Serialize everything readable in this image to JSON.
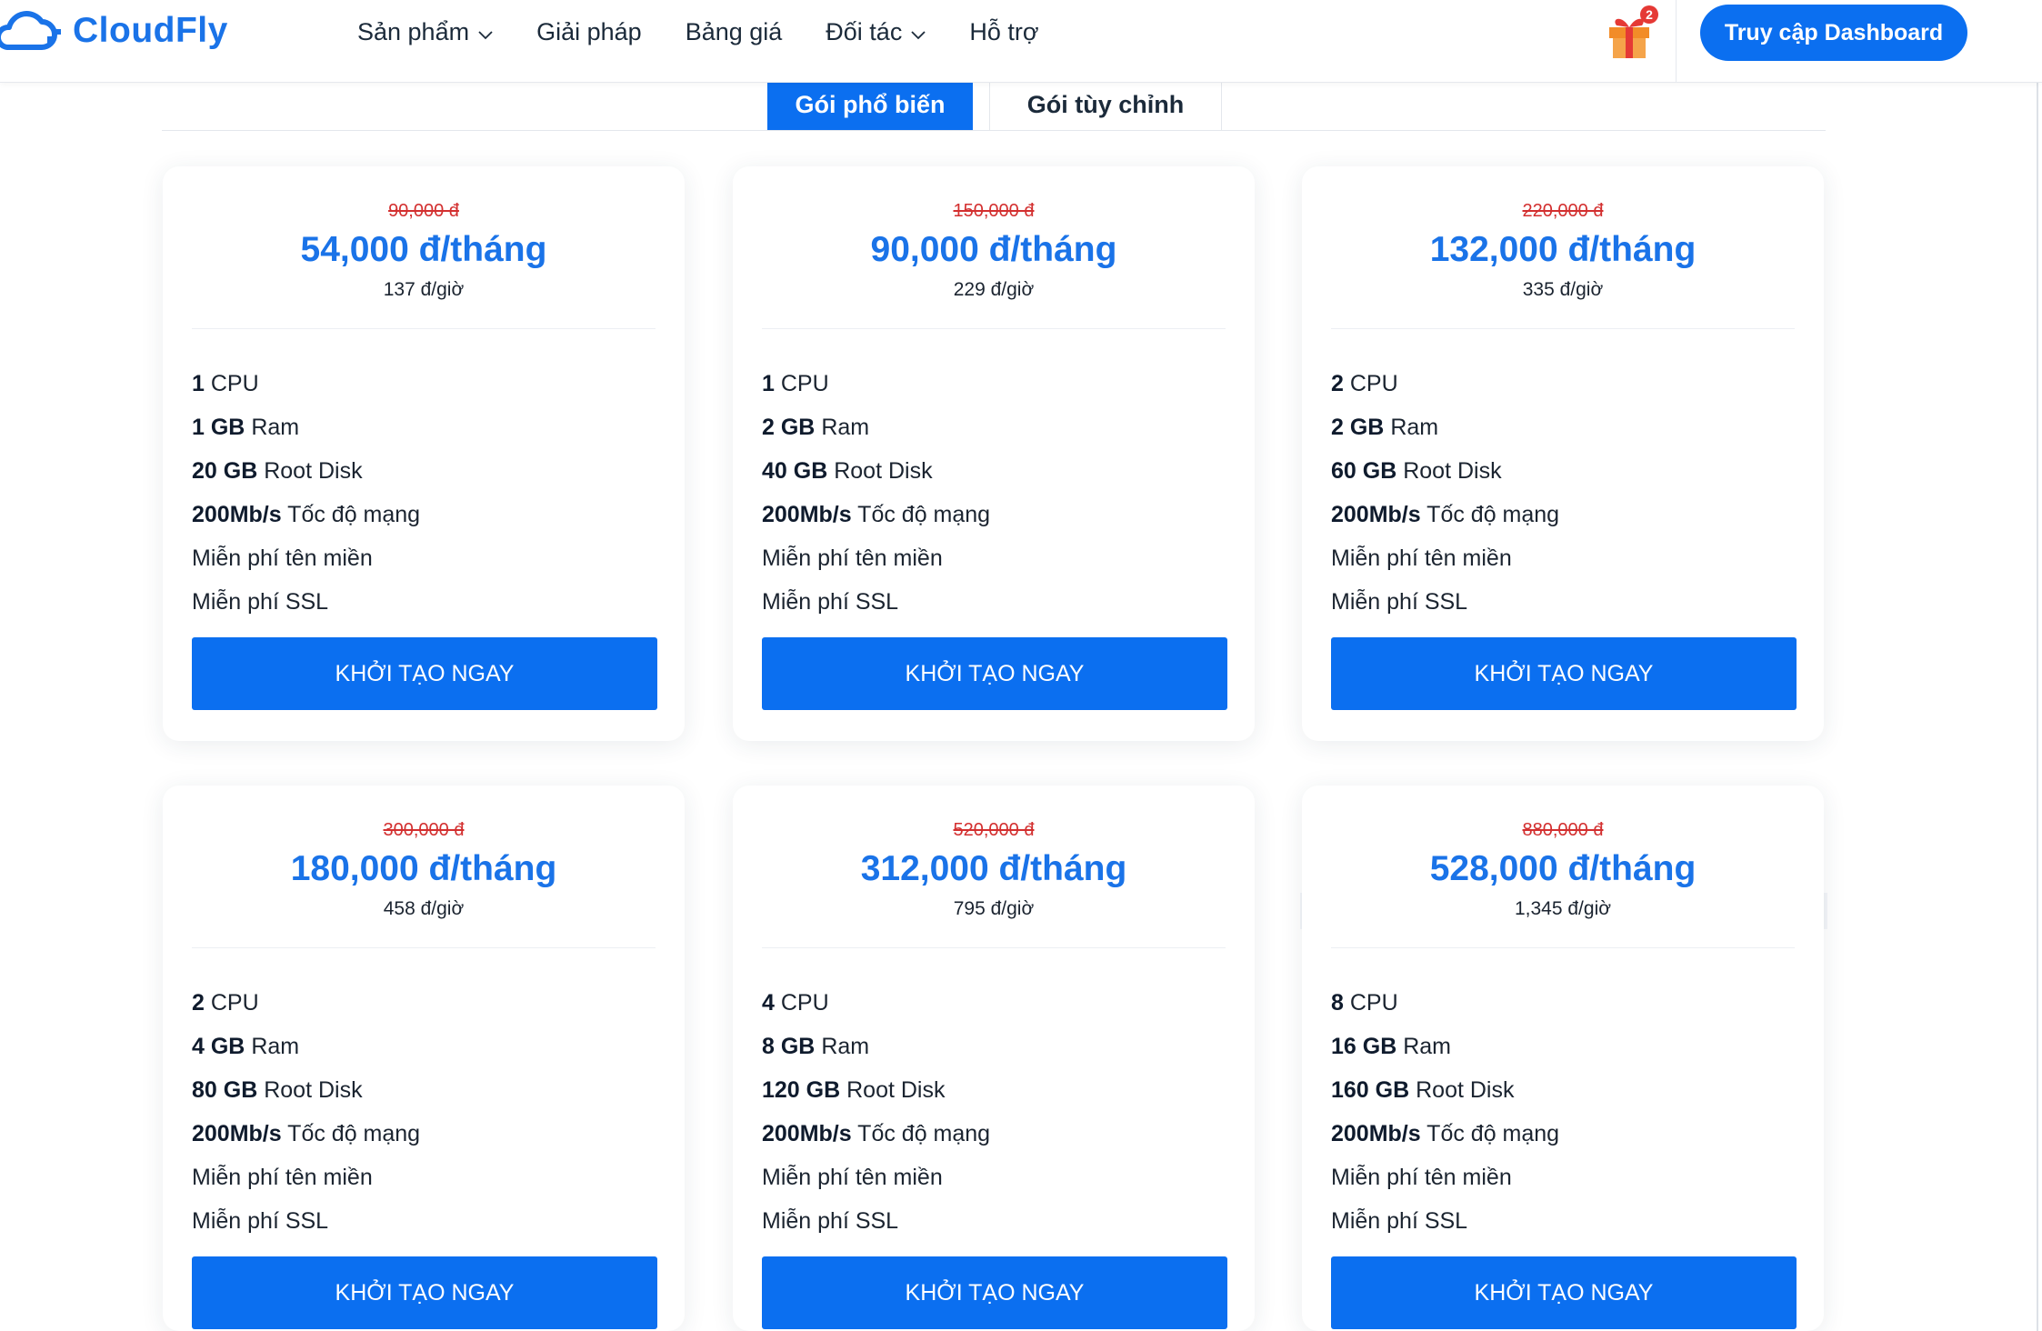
{
  "header": {
    "logo_text": "CloudFly",
    "nav": [
      {
        "label": "Sản phẩm",
        "dropdown": true
      },
      {
        "label": "Giải pháp",
        "dropdown": false
      },
      {
        "label": "Bảng giá",
        "dropdown": false
      },
      {
        "label": "Đối tác",
        "dropdown": true
      },
      {
        "label": "Hỗ trợ",
        "dropdown": false
      }
    ],
    "gift_badge": "2",
    "dashboard_button": "Truy cập Dashboard"
  },
  "tabs": {
    "active": "Gói phổ biến",
    "inactive": "Gói tùy chỉnh"
  },
  "colors": {
    "accent": "#0b6ff0",
    "price": "#1a73e8",
    "old_price": "#d32f2f"
  },
  "plans": [
    {
      "old_price": "90,000 đ",
      "price": "54,000 đ/tháng",
      "hourly": "137 đ/giờ",
      "cpu": "1",
      "ram": "1 GB",
      "disk": "20 GB",
      "net": "200Mb/s",
      "button": "KHỞI TẠO NGAY"
    },
    {
      "old_price": "150,000 đ",
      "price": "90,000 đ/tháng",
      "hourly": "229 đ/giờ",
      "cpu": "1",
      "ram": "2 GB",
      "disk": "40 GB",
      "net": "200Mb/s",
      "button": "KHỞI TẠO NGAY"
    },
    {
      "old_price": "220,000 đ",
      "price": "132,000 đ/tháng",
      "hourly": "335 đ/giờ",
      "cpu": "2",
      "ram": "2 GB",
      "disk": "60 GB",
      "net": "200Mb/s",
      "button": "KHỞI TẠO NGAY"
    },
    {
      "old_price": "300,000 đ",
      "price": "180,000 đ/tháng",
      "hourly": "458 đ/giờ",
      "cpu": "2",
      "ram": "4 GB",
      "disk": "80 GB",
      "net": "200Mb/s",
      "button": "KHỞI TẠO NGAY"
    },
    {
      "old_price": "520,000 đ",
      "price": "312,000 đ/tháng",
      "hourly": "795 đ/giờ",
      "cpu": "4",
      "ram": "8 GB",
      "disk": "120 GB",
      "net": "200Mb/s",
      "button": "KHỞI TẠO NGAY"
    },
    {
      "old_price": "880,000 đ",
      "price": "528,000 đ/tháng",
      "hourly": "1,345 đ/giờ",
      "cpu": "8",
      "ram": "16 GB",
      "disk": "160 GB",
      "net": "200Mb/s",
      "button": "KHỞI TẠO NGAY"
    }
  ],
  "feature_labels": {
    "cpu": "CPU",
    "ram": "Ram",
    "disk": "Root Disk",
    "net": "Tốc độ mạng",
    "free_domain": "Miễn phí tên miền",
    "free_ssl": "Miễn phí SSL"
  }
}
